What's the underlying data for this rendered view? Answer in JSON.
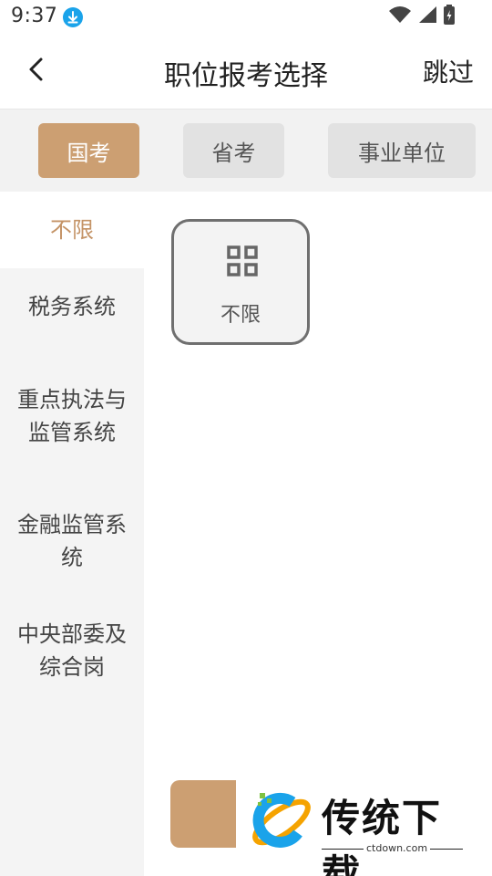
{
  "status_bar": {
    "time": "9:37",
    "icons": [
      "download-icon",
      "wifi-icon",
      "signal-icon",
      "battery-charging-icon"
    ]
  },
  "header": {
    "title": "职位报考选择",
    "skip_label": "跳过",
    "back_icon": "chevron-left-icon"
  },
  "tabs": [
    {
      "label": "国考",
      "active": true
    },
    {
      "label": "省考",
      "active": false
    },
    {
      "label": "事业单位",
      "active": false
    }
  ],
  "sidebar": {
    "items": [
      {
        "label": "不限",
        "active": true
      },
      {
        "label": "税务系统",
        "active": false
      },
      {
        "label": "重点执法与监管系统",
        "active": false
      },
      {
        "label": "金融监管系统",
        "active": false
      },
      {
        "label": "中央部委及综合岗",
        "active": false
      }
    ]
  },
  "options": [
    {
      "label": "不限",
      "icon": "grid-icon"
    }
  ],
  "watermark": {
    "brand": "传统下载",
    "url": "ctdown.com"
  },
  "colors": {
    "accent": "#cc9f72",
    "active_text": "#c49366",
    "download_badge": "#1aa3ea"
  }
}
